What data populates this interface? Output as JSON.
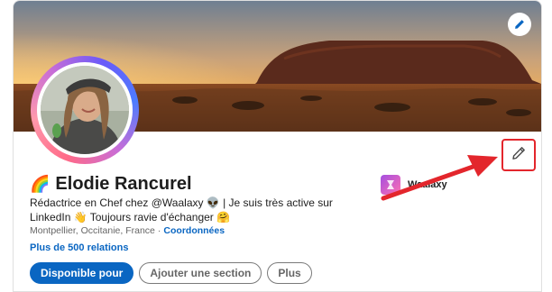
{
  "profile": {
    "name_emoji": "🌈",
    "name": "Elodie Rancurel",
    "headline": "Rédactrice en Chef chez @Waalaxy 👽 | Je suis très active sur LinkedIn 👋 Toujours ravie d'échanger 🤗",
    "location": "Montpellier, Occitanie, France",
    "location_separator": "·",
    "contact_link": "Coordonnées",
    "connections": "Plus de 500 relations"
  },
  "actions": {
    "open_to": "Disponible pour",
    "add_section": "Ajouter une section",
    "more": "Plus"
  },
  "company": {
    "name": "Waalaxy"
  },
  "icons": {
    "edit_banner": "pencil-icon",
    "edit_profile": "pencil-icon",
    "annotation": "red-arrow"
  },
  "colors": {
    "primary": "#0a66c2",
    "highlight": "#e3262c",
    "text": "#1d1d1d",
    "muted": "#666666"
  }
}
